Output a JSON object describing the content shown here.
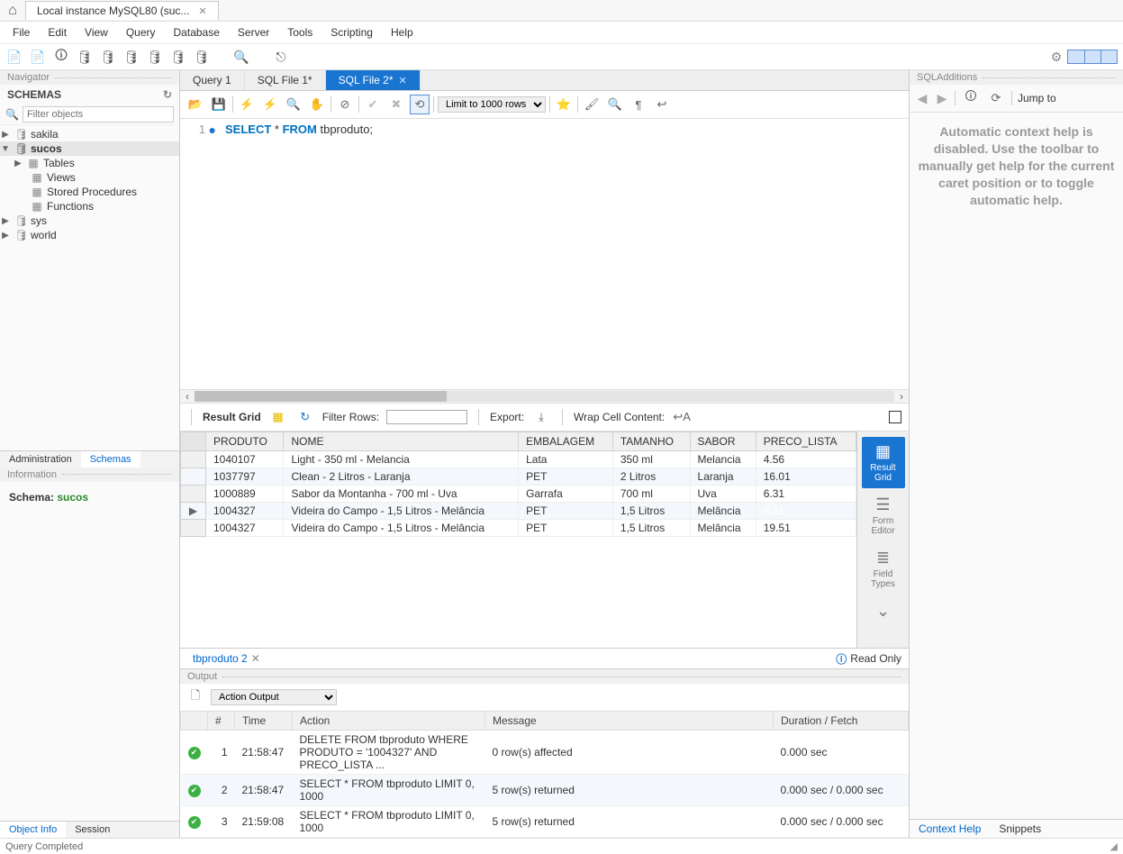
{
  "titlebar": {
    "tab": "Local instance MySQL80 (suc..."
  },
  "menubar": [
    "File",
    "Edit",
    "View",
    "Query",
    "Database",
    "Server",
    "Tools",
    "Scripting",
    "Help"
  ],
  "navigator": {
    "title": "Navigator",
    "schemas_label": "SCHEMAS",
    "filter_placeholder": "Filter objects",
    "tree": {
      "sakila": "sakila",
      "sucos": "sucos",
      "children": {
        "tables": "Tables",
        "views": "Views",
        "sprocs": "Stored Procedures",
        "functions": "Functions"
      },
      "sys": "sys",
      "world": "world"
    },
    "tabs": {
      "admin": "Administration",
      "schemas": "Schemas"
    },
    "info_title": "Information",
    "info_label": "Schema:",
    "info_value": "sucos",
    "bottom_tabs": {
      "objinfo": "Object Info",
      "session": "Session"
    }
  },
  "editor": {
    "tabs": {
      "q1": "Query 1",
      "f1": "SQL File 1*",
      "f2": "SQL File 2*"
    },
    "limit_label": "Limit to 1000 rows",
    "line_no": "1",
    "code_kw1": "SELECT",
    "code_mid": " * ",
    "code_kw2": "FROM",
    "code_rest": " tbproduto;"
  },
  "grid": {
    "toolbar": {
      "result_grid": "Result Grid",
      "filter_rows": "Filter Rows:",
      "export": "Export:",
      "wrap": "Wrap Cell Content:"
    },
    "columns": [
      "PRODUTO",
      "NOME",
      "EMBALAGEM",
      "TAMANHO",
      "SABOR",
      "PRECO_LISTA"
    ],
    "rows": [
      {
        "produto": "1040107",
        "nome": "Light - 350 ml - Melancia",
        "embalagem": "Lata",
        "tamanho": "350 ml",
        "sabor": "Melancia",
        "preco": "4.56"
      },
      {
        "produto": "1037797",
        "nome": "Clean - 2 Litros - Laranja",
        "embalagem": "PET",
        "tamanho": "2 Litros",
        "sabor": "Laranja",
        "preco": "16.01"
      },
      {
        "produto": "1000889",
        "nome": "Sabor da Montanha - 700 ml - Uva",
        "embalagem": "Garrafa",
        "tamanho": "700 ml",
        "sabor": "Uva",
        "preco": "6.31"
      },
      {
        "produto": "1004327",
        "nome": "Videira do Campo - 1,5 Litros - Melância",
        "embalagem": "PET",
        "tamanho": "1,5 Litros",
        "sabor": "Melância",
        "preco": "6.31"
      },
      {
        "produto": "1004327",
        "nome": "Videira do Campo - 1,5 Litros - Melância",
        "embalagem": "PET",
        "tamanho": "1,5 Litros",
        "sabor": "Melância",
        "preco": "19.51"
      }
    ],
    "selected_cell": {
      "row": 3,
      "col": "preco"
    },
    "current_row": 3,
    "side": {
      "result": "Result Grid",
      "form": "Form Editor",
      "types": "Field Types"
    },
    "tabname": "tbproduto 2",
    "readonly": "Read Only"
  },
  "output": {
    "title": "Output",
    "dropdown": "Action Output",
    "columns": {
      "num": "#",
      "time": "Time",
      "action": "Action",
      "message": "Message",
      "duration": "Duration / Fetch"
    },
    "rows": [
      {
        "n": "1",
        "time": "21:58:47",
        "action": "DELETE FROM tbproduto WHERE PRODUTO = '1004327' AND PRECO_LISTA ...",
        "msg": "0 row(s) affected",
        "dur": "0.000 sec"
      },
      {
        "n": "2",
        "time": "21:58:47",
        "action": "SELECT * FROM tbproduto LIMIT 0, 1000",
        "msg": "5 row(s) returned",
        "dur": "0.000 sec / 0.000 sec"
      },
      {
        "n": "3",
        "time": "21:59:08",
        "action": "SELECT * FROM tbproduto LIMIT 0, 1000",
        "msg": "5 row(s) returned",
        "dur": "0.000 sec / 0.000 sec"
      }
    ]
  },
  "right": {
    "title": "SQLAdditions",
    "jump": "Jump to",
    "help": "Automatic context help is disabled. Use the toolbar to manually get help for the current caret position or to toggle automatic help.",
    "tabs": {
      "ctx": "Context Help",
      "snip": "Snippets"
    }
  },
  "status": "Query Completed"
}
